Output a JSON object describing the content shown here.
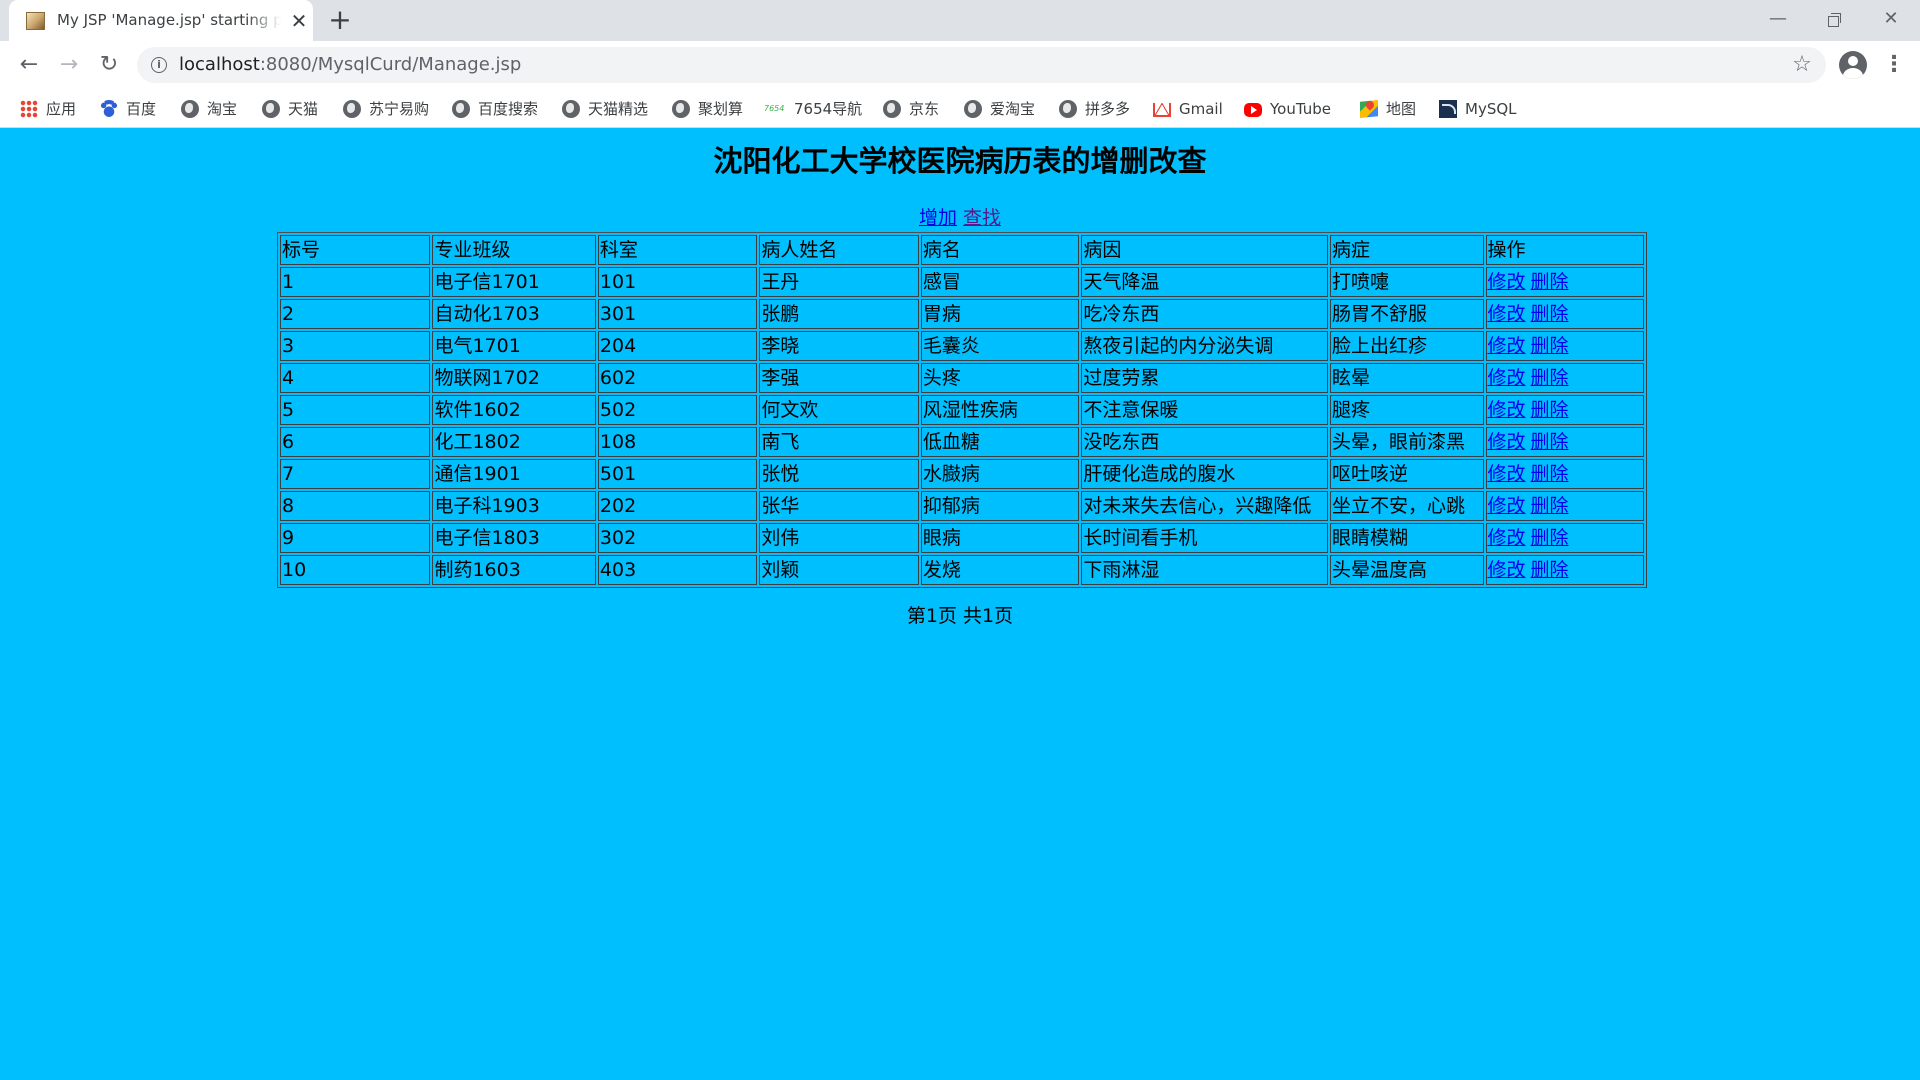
{
  "browser": {
    "tab": {
      "title": "My JSP 'Manage.jsp' starting page",
      "close_glyph": "✕"
    },
    "new_tab_glyph": "+",
    "window_controls": {
      "minimize": "—",
      "close": "✕"
    },
    "toolbar": {
      "back_glyph": "←",
      "forward_glyph": "→",
      "reload_glyph": "↻",
      "url_host": "localhost",
      "url_path": ":8080/MysqlCurd/Manage.jsp",
      "info_glyph": "i",
      "star_glyph": "☆",
      "menu_glyph": "⋮"
    },
    "bookmarks": [
      {
        "label": "应用",
        "icon": "apps-icon"
      },
      {
        "label": "百度",
        "icon": "baidu-icon"
      },
      {
        "label": "淘宝",
        "icon": "globe-icon"
      },
      {
        "label": "天猫",
        "icon": "globe-icon"
      },
      {
        "label": "苏宁易购",
        "icon": "globe-icon"
      },
      {
        "label": "百度搜索",
        "icon": "globe-icon"
      },
      {
        "label": "天猫精选",
        "icon": "globe-icon"
      },
      {
        "label": "聚划算",
        "icon": "globe-icon"
      },
      {
        "label": "7654导航",
        "icon": "7654-icon",
        "icon_text": "7654"
      },
      {
        "label": "京东",
        "icon": "globe-icon"
      },
      {
        "label": "爱淘宝",
        "icon": "globe-icon"
      },
      {
        "label": "拼多多",
        "icon": "globe-icon"
      },
      {
        "label": "Gmail",
        "icon": "gmail-icon"
      },
      {
        "label": "YouTube",
        "icon": "youtube-icon"
      },
      {
        "label": "地图",
        "icon": "maps-icon"
      },
      {
        "label": "MySQL",
        "icon": "mysql-icon"
      }
    ]
  },
  "page": {
    "background": "#00bfff",
    "title": "沈阳化工大学校医院病历表的增删改查",
    "add_link": "增加",
    "search_link": "查找",
    "table": {
      "headers": [
        "标号",
        "专业班级",
        "科室",
        "病人姓名",
        "病名",
        "病因",
        "病症",
        "操作"
      ],
      "edit_label": "修改",
      "delete_label": "删除",
      "rows": [
        [
          "1",
          "电子信1701",
          "101",
          "王丹",
          "感冒",
          "天气降温",
          "打喷嚏"
        ],
        [
          "2",
          "自动化1703",
          "301",
          "张鹏",
          "胃病",
          "吃冷东西",
          "肠胃不舒服"
        ],
        [
          "3",
          "电气1701",
          "204",
          "李晓",
          "毛囊炎",
          "熬夜引起的内分泌失调",
          "脸上出红疹"
        ],
        [
          "4",
          "物联网1702",
          "602",
          "李强",
          "头疼",
          "过度劳累",
          "眩晕"
        ],
        [
          "5",
          "软件1602",
          "502",
          "何文欢",
          "风湿性疾病",
          "不注意保暖",
          "腿疼"
        ],
        [
          "6",
          "化工1802",
          "108",
          "南飞",
          "低血糖",
          "没吃东西",
          "头晕，眼前漆黑"
        ],
        [
          "7",
          "通信1901",
          "501",
          "张悦",
          "水臌病",
          "肝硬化造成的腹水",
          "呕吐咳逆"
        ],
        [
          "8",
          "电子科1903",
          "202",
          "张华",
          "抑郁病",
          "对未来失去信心，兴趣降低",
          "坐立不安，心跳"
        ],
        [
          "9",
          "电子信1803",
          "302",
          "刘伟",
          "眼病",
          "长时间看手机",
          "眼睛模糊"
        ],
        [
          "10",
          "制药1603",
          "403",
          "刘颖",
          "发烧",
          "下雨淋湿",
          "头晕温度高"
        ]
      ]
    },
    "pager": "第1页 共1页"
  }
}
